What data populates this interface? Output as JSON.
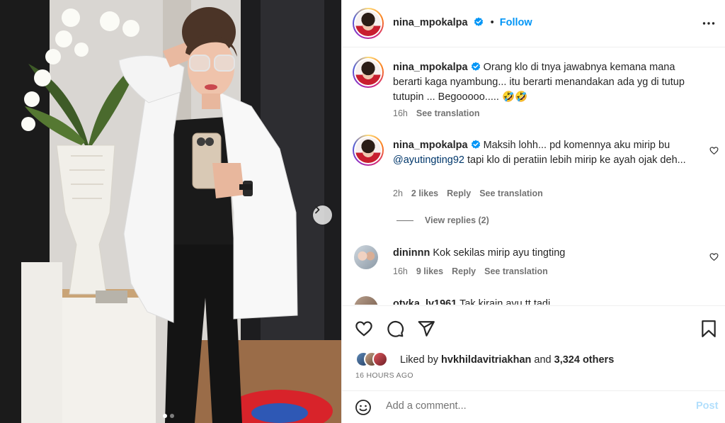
{
  "post": {
    "photo_alt": "Mirror selfie photo",
    "carousel": {
      "count": 2,
      "active": 1
    }
  },
  "header": {
    "username": "nina_mpokalpa",
    "separator": "•",
    "follow_label": "Follow"
  },
  "comments": [
    {
      "username": "nina_mpokalpa",
      "text": "Orang klo di tnya jawabnya kemana mana berarti kaga nyambung... itu berarti menandakan ada yg di tutup tutupin ... Begooooo..... 🤣🤣",
      "time": "16h",
      "see_translation": "See translation"
    },
    {
      "username": "nina_mpokalpa",
      "text_before": "Maksih lohh... pd komennya aku mirip bu",
      "mention": "@ayutingting92",
      "text_after": "tapi klo di peratiin lebih mirip ke ayah ojak deh...",
      "time": "2h",
      "likes": "2 likes",
      "reply": "Reply",
      "see_translation": "See translation",
      "view_replies": "View replies (2)"
    },
    {
      "username": "dininnn",
      "text": "Kok sekilas mirip ayu tingting",
      "time": "16h",
      "likes": "9 likes",
      "reply": "Reply",
      "see_translation": "See translation"
    },
    {
      "username": "otyka_lv1961",
      "text": "Tak kirain ayu tt tadi"
    }
  ],
  "likes_summary": {
    "prefix": "Liked by",
    "user": "hvkhildavitriakhan",
    "middle": "and",
    "others": "3,324 others"
  },
  "timestamp": "16 HOURS AGO",
  "add_comment": {
    "placeholder": "Add a comment...",
    "post_label": "Post"
  },
  "colors": {
    "accent": "#0095f6",
    "post_disabled": "#b2dffc",
    "verified": "#0095f6"
  }
}
